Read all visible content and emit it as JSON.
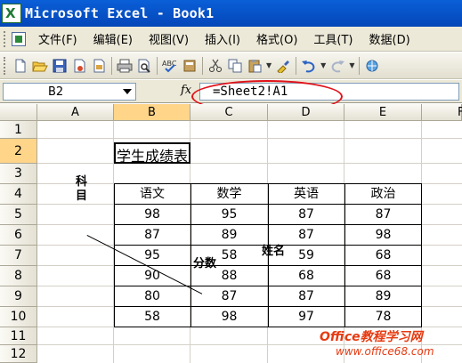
{
  "window": {
    "title": "Microsoft Excel - Book1"
  },
  "menu": {
    "items": [
      "文件(F)",
      "编辑(E)",
      "视图(V)",
      "插入(I)",
      "格式(O)",
      "工具(T)",
      "数据(D)"
    ]
  },
  "toolbar": {
    "icons": [
      "new-icon",
      "open-icon",
      "save-icon",
      "permission-icon",
      "print-icon",
      "print-preview-icon",
      "spelling-icon",
      "research-icon",
      "cut-icon",
      "copy-icon",
      "paste-icon",
      "format-painter-icon",
      "undo-icon",
      "redo-icon"
    ]
  },
  "formula_bar": {
    "name_box": "B2",
    "fx": "fx",
    "formula": "=Sheet2!A1"
  },
  "grid": {
    "columns": [
      "A",
      "B",
      "C",
      "D",
      "E",
      "F"
    ],
    "rows": [
      "1",
      "2",
      "3",
      "4",
      "5",
      "6",
      "7",
      "8",
      "9",
      "10",
      "11",
      "12"
    ],
    "selected_column": "B",
    "selected_row": "2"
  },
  "sheet": {
    "b2_title": "学生成绩表",
    "diag_top": "科目",
    "diag_bottom": "分数",
    "diag_right": "姓名",
    "headers": [
      "语文",
      "数学",
      "英语",
      "政治"
    ],
    "rows": [
      [
        "98",
        "95",
        "87",
        "87"
      ],
      [
        "87",
        "89",
        "87",
        "98"
      ],
      [
        "95",
        "58",
        "59",
        "68"
      ],
      [
        "90",
        "88",
        "68",
        "68"
      ],
      [
        "80",
        "87",
        "87",
        "89"
      ],
      [
        "58",
        "98",
        "97",
        "78"
      ]
    ]
  },
  "watermark": {
    "line1": "Office教程学习网",
    "line2": "www.office68.com"
  },
  "colors": {
    "title_bar": "#0a5fd8",
    "highlight": "#e1121a",
    "selected_header": "#ffd58a"
  }
}
